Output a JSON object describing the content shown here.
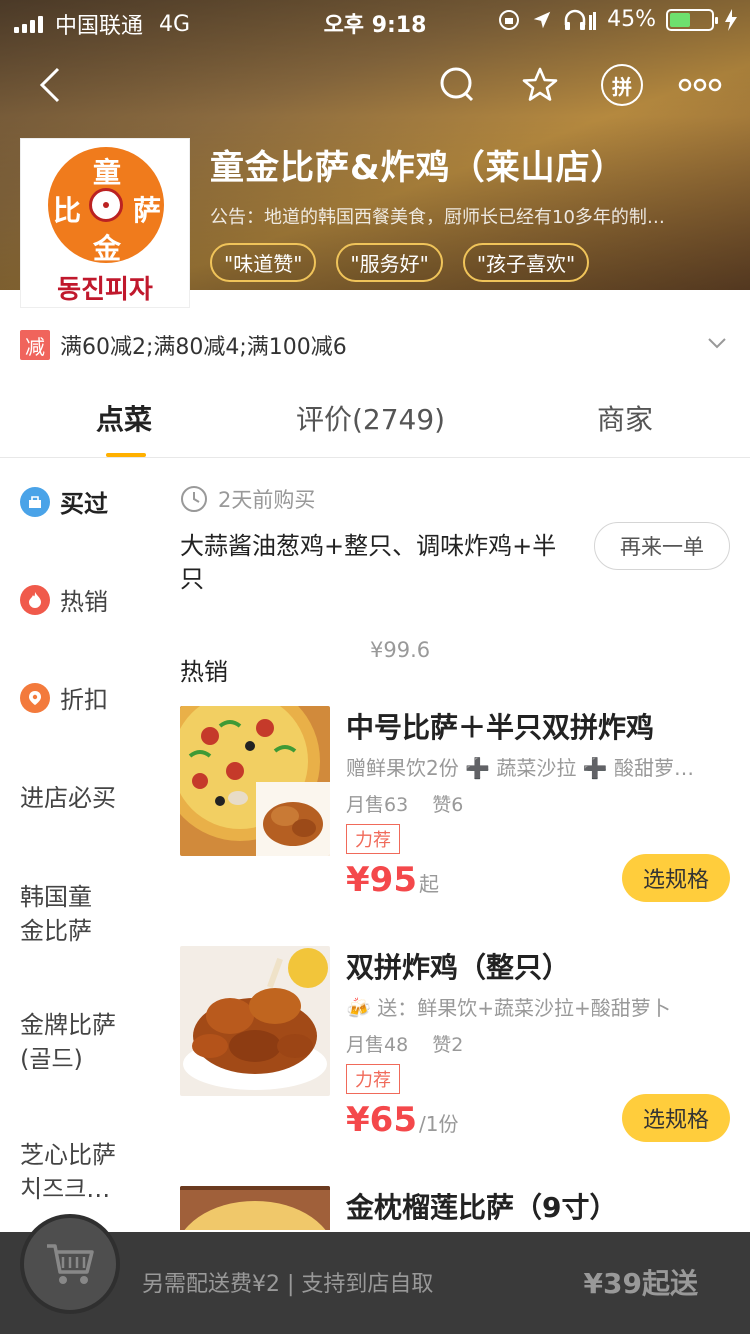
{
  "status_bar": {
    "carrier": "中国联通",
    "network": "4G",
    "time": "오후 9:18",
    "battery": "45%"
  },
  "shop": {
    "name": "童金比萨&炸鸡（莱山店）",
    "notice": "公告：地道的韩国西餐美食，厨师长已经有10多年的制…",
    "logo_chars": [
      "童",
      "比",
      "萨",
      "金"
    ],
    "logo_korean": "동진피자",
    "tags": [
      "\"味道赞\"",
      "\"服务好\"",
      "\"孩子喜欢\""
    ]
  },
  "header_icons": [
    "back-icon",
    "search-icon",
    "star-icon",
    "pin-icon",
    "more-icon"
  ],
  "header_pin_label": "拼",
  "promo": {
    "badge": "减",
    "text": "满60减2;满80减4;满100减6"
  },
  "tabs": [
    "点菜",
    "评价(2749)",
    "商家"
  ],
  "sidebar": {
    "items": [
      {
        "label": "买过"
      },
      {
        "label": "热销"
      },
      {
        "label": "折扣"
      },
      {
        "label": "进店必买"
      },
      {
        "label_line1": "韩国童",
        "label_line2": "金比萨"
      },
      {
        "label_line1": "金牌比萨",
        "label_line2": "(골드)"
      },
      {
        "label_line1": "芝心比萨",
        "label_line2": "치즈크…"
      }
    ]
  },
  "bought": {
    "when": "2天前购买",
    "price": "¥99.6",
    "name": "大蒜酱油葱鸡+整只、调味炸鸡+半只",
    "reorder_label": "再来一单"
  },
  "section_title": "热销",
  "dishes": [
    {
      "name": "中号比萨＋半只双拼炸鸡",
      "desc": "赠鲜果饮2份 ➕ 蔬菜沙拉 ➕ 酸甜萝…",
      "monthly": "月售63",
      "likes": "赞6",
      "rec": "力荐",
      "price": "¥95",
      "price_suffix": "起",
      "button": "选规格"
    },
    {
      "name": "双拼炸鸡（整只）",
      "desc": "🍻 送：鲜果饮+蔬菜沙拉+酸甜萝卜",
      "monthly": "月售48",
      "likes": "赞2",
      "rec": "力荐",
      "price": "¥65",
      "price_suffix": "/1份",
      "button": "选规格"
    },
    {
      "name": "金枕榴莲比萨（9寸）"
    }
  ],
  "bottom_bar": {
    "fee_text": "另需配送费¥2 | 支持到店自取",
    "min_order": "¥39起送"
  },
  "colors": {
    "accent_yellow": "#ffcd3c",
    "price_red": "#f4484b",
    "tab_underline": "#ffb000",
    "bottom_bar": "#3a3a3a"
  }
}
